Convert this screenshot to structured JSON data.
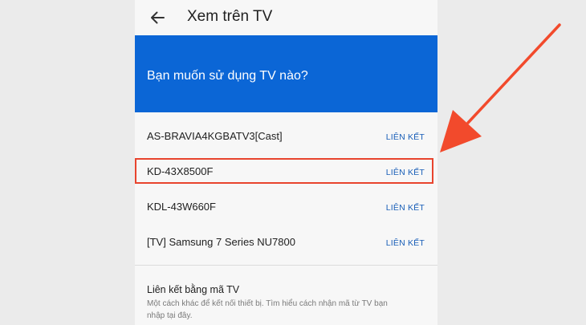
{
  "app_bar": {
    "title": "Xem trên TV",
    "back_icon": "arrow-left-icon"
  },
  "banner": {
    "text": "Bạn muốn sử dụng TV nào?",
    "color": "#0b66d6"
  },
  "devices": [
    {
      "name": "AS-BRAVIA4KGBATV3[Cast]",
      "action": "LIÊN KẾT"
    },
    {
      "name": "KD-43X8500F",
      "action": "LIÊN KẾT"
    },
    {
      "name": "KDL-43W660F",
      "action": "LIÊN KẾT"
    },
    {
      "name": "[TV] Samsung 7 Series NU7800",
      "action": "LIÊN KẾT"
    }
  ],
  "link_by_code": {
    "title": "Liên kết bằng mã TV",
    "description": "Một cách khác để kết nối thiết bị. Tìm hiểu cách nhận mã từ TV bạn nhập tại đây."
  },
  "annotation": {
    "highlight_color": "#e8442e",
    "arrow_color": "#f24a2c"
  }
}
